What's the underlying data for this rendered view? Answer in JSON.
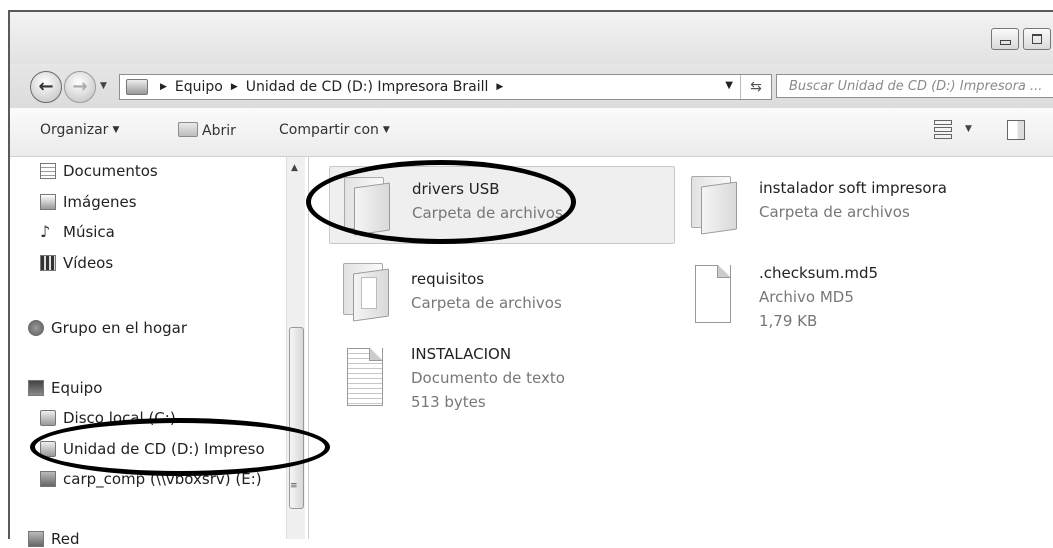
{
  "address": {
    "crumbs": [
      "Equipo",
      "Unidad de CD (D:) Impresora Braill"
    ],
    "search_placeholder": "Buscar Unidad de CD (D:) Impresora ..."
  },
  "toolbar": {
    "organize": "Organizar",
    "open": "Abrir",
    "share": "Compartir con"
  },
  "sidebar": {
    "items": [
      {
        "label": "Documentos",
        "icon": "document-icon"
      },
      {
        "label": "Imágenes",
        "icon": "image-icon"
      },
      {
        "label": "Música",
        "icon": "music-icon"
      },
      {
        "label": "Vídeos",
        "icon": "video-icon"
      },
      {
        "label": "Grupo en el hogar",
        "icon": "homegroup-icon"
      },
      {
        "label": "Equipo",
        "icon": "computer-icon"
      },
      {
        "label": "Disco local (C:)",
        "icon": "hard-drive-icon"
      },
      {
        "label": "Unidad de CD (D:) Impreso",
        "icon": "cd-drive-icon"
      },
      {
        "label": "carp_comp (\\\\vboxsrv) (E:)",
        "icon": "network-drive-icon"
      },
      {
        "label": "Red",
        "icon": "network-icon"
      }
    ]
  },
  "files": [
    {
      "name": "drivers USB",
      "type": "Carpeta de archivos",
      "size": ""
    },
    {
      "name": "instalador soft impresora",
      "type": "Carpeta de archivos",
      "size": ""
    },
    {
      "name": "requisitos",
      "type": "Carpeta de archivos",
      "size": ""
    },
    {
      "name": ".checksum.md5",
      "type": "Archivo MD5",
      "size": "1,79 KB"
    },
    {
      "name": "INSTALACION",
      "type": "Documento de texto",
      "size": "513 bytes"
    }
  ]
}
